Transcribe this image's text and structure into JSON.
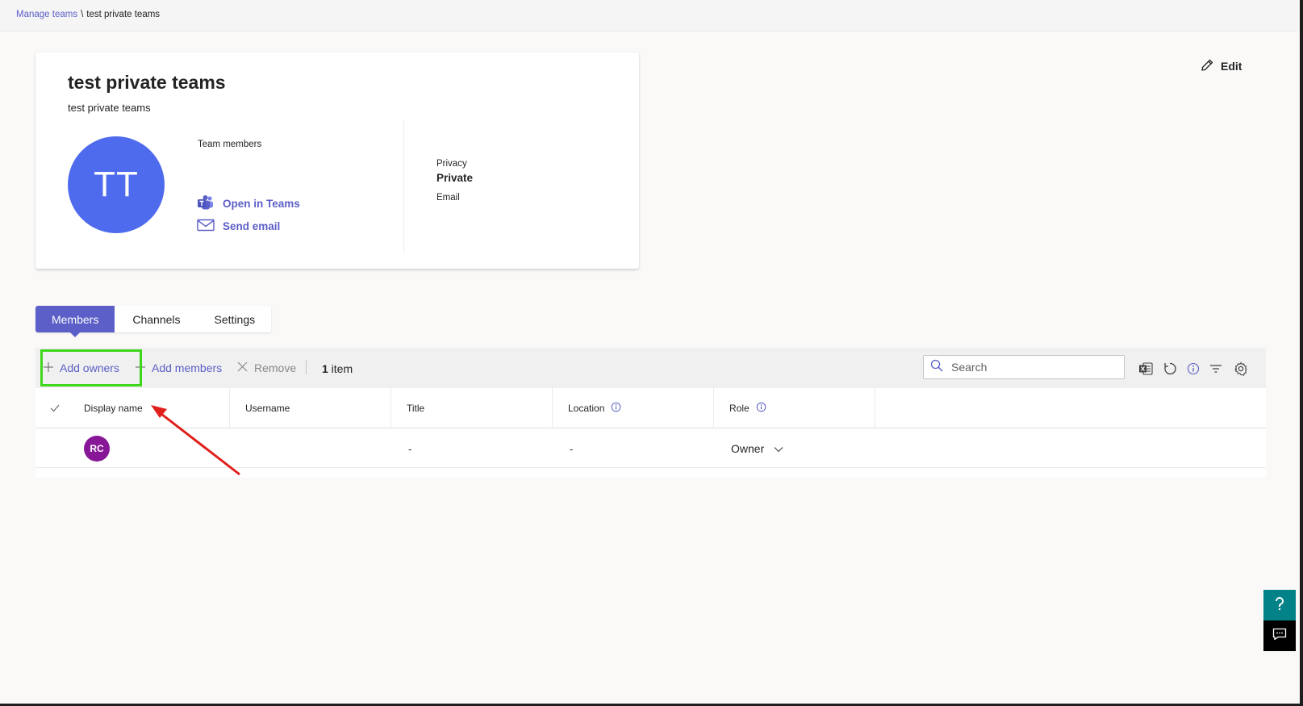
{
  "breadcrumb": {
    "parent": "Manage teams",
    "separator": "\\",
    "current": "test private teams"
  },
  "actions": {
    "edit_label": "Edit"
  },
  "team_card": {
    "name": "test private teams",
    "description": "test private teams",
    "avatar_initials": "TT",
    "avatar_color": "#4f6bed",
    "members_label": "Team members",
    "open_in_teams_label": "Open in Teams",
    "send_email_label": "Send email",
    "privacy_label": "Privacy",
    "privacy_value": "Private",
    "email_label": "Email"
  },
  "tabs": [
    {
      "label": "Members",
      "active": true
    },
    {
      "label": "Channels",
      "active": false
    },
    {
      "label": "Settings",
      "active": false
    }
  ],
  "toolbar": {
    "add_owners_label": "Add owners",
    "add_members_label": "Add members",
    "remove_label": "Remove",
    "item_count": "1",
    "item_count_suffix": " item",
    "search_placeholder": "Search"
  },
  "table": {
    "columns": [
      "Display name",
      "Username",
      "Title",
      "Location",
      "Role"
    ],
    "rows": [
      {
        "avatar_initials": "RC",
        "avatar_color": "#881798",
        "display_name": "",
        "username": "",
        "title": "-",
        "location": "-",
        "role": "Owner"
      }
    ]
  },
  "icons": {
    "edit": "pencil-icon",
    "teams": "teams-logo-icon",
    "email": "mail-icon",
    "add": "plus-icon",
    "remove": "close-icon",
    "search": "search-icon",
    "export": "excel-export-icon",
    "refresh": "refresh-icon",
    "info": "info-icon",
    "filter": "filter-icon",
    "settings": "gear-icon",
    "help": "help-icon",
    "feedback": "feedback-icon"
  },
  "colors": {
    "accent": "#5b5fc7",
    "highlight_box": "#3ed61a",
    "annotation_arrow": "#e0201b",
    "help_button": "#038387"
  }
}
